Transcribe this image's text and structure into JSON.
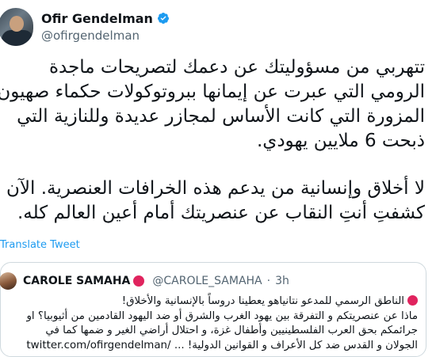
{
  "author": {
    "name": "Ofir Gendelman",
    "handle": "@ofirgendelman",
    "verified": true
  },
  "tweet": {
    "paragraphs": [
      "تتهربي من مسؤوليتك عن دعمك لتصريحات ماجدة الرومي التي عبرت عن إيمانها ببروتوكولات حكماء صهيون المزورة التي كانت الأساس لمجازر عديدة وللنازية التي ذبحت 6 ملايين يهودي.",
      "لا أخلاق وإنسانية من يدعم هذه الخرافات العنصرية. الآن كشفتِ أنتِ النقاب عن عنصريتك أمام أعين العالم كله."
    ],
    "translate_label": "Translate Tweet"
  },
  "quoted": {
    "name": "CAROLE SAMAHA",
    "handle": "@CAROLE_SAMAHA",
    "separator": "·",
    "time": "3h",
    "lines": [
      "الناطق الرسمي للمدعو نتانياهو يعطينا دروساً بالإنسانية والأخلاق!",
      "ماذا عن عنصريتكم و التفرقة بين يهود الغرب والشرق أو ضد اليهود القادمين من أثيوبيا؟ او",
      "جرائمكم بحق العرب الفلسطينيين وأطفال غزة، و احتلال أراضي الغير و ضمها كما في",
      "الجولان و القدس ضد كل الأعراف و القوانين الدولية! ..."
    ],
    "link": "twitter.com/ofirgendelman/"
  },
  "colors": {
    "accent": "#1d9bf0",
    "text": "#0f1419",
    "muted": "#536471",
    "border": "#cfd9de",
    "red_circle": "#e0245e"
  },
  "icons": [
    "verified-badge-icon",
    "red-circle-icon"
  ]
}
